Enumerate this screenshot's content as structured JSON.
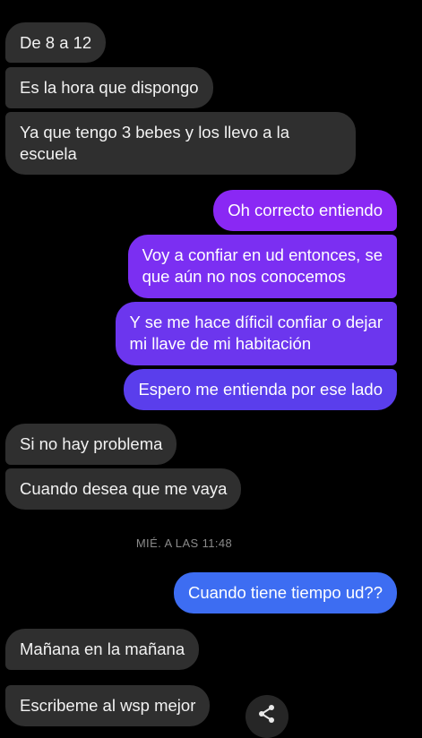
{
  "messages": [
    {
      "text": "De 8 a 12",
      "sender": "them"
    },
    {
      "text": "Es la hora que dispongo",
      "sender": "them"
    },
    {
      "text": "Ya que tengo 3 bebes y los llevo a la\nescuela",
      "sender": "them"
    },
    {
      "text": "Oh correcto entiendo",
      "sender": "me"
    },
    {
      "text": "Voy a confiar en ud entonces, se\nque aún no nos conocemos",
      "sender": "me"
    },
    {
      "text": "Y se me hace díficil confiar o dejar\nmi llave de mi habitación",
      "sender": "me"
    },
    {
      "text": "Espero me entienda por ese lado",
      "sender": "me"
    },
    {
      "text": "Si no hay problema",
      "sender": "them"
    },
    {
      "text": "Cuando desea que me vaya",
      "sender": "them"
    },
    {
      "text": "Cuando tiene tiempo ud??",
      "sender": "me"
    },
    {
      "text": "Mañana en la mañana",
      "sender": "them"
    },
    {
      "text": "Escribeme al wsp mejor",
      "sender": "them"
    }
  ],
  "timestamp": "MIÉ. A LAS 11:48",
  "icons": {
    "share": "share-icon"
  },
  "colors": {
    "background": "#000000",
    "incoming_bubble": "#2f2f2f",
    "outgoing_gradient_top": "#7b2ff7",
    "outgoing_gradient_bottom": "#3d6df2",
    "timestamp_text": "#8a8a8a"
  }
}
